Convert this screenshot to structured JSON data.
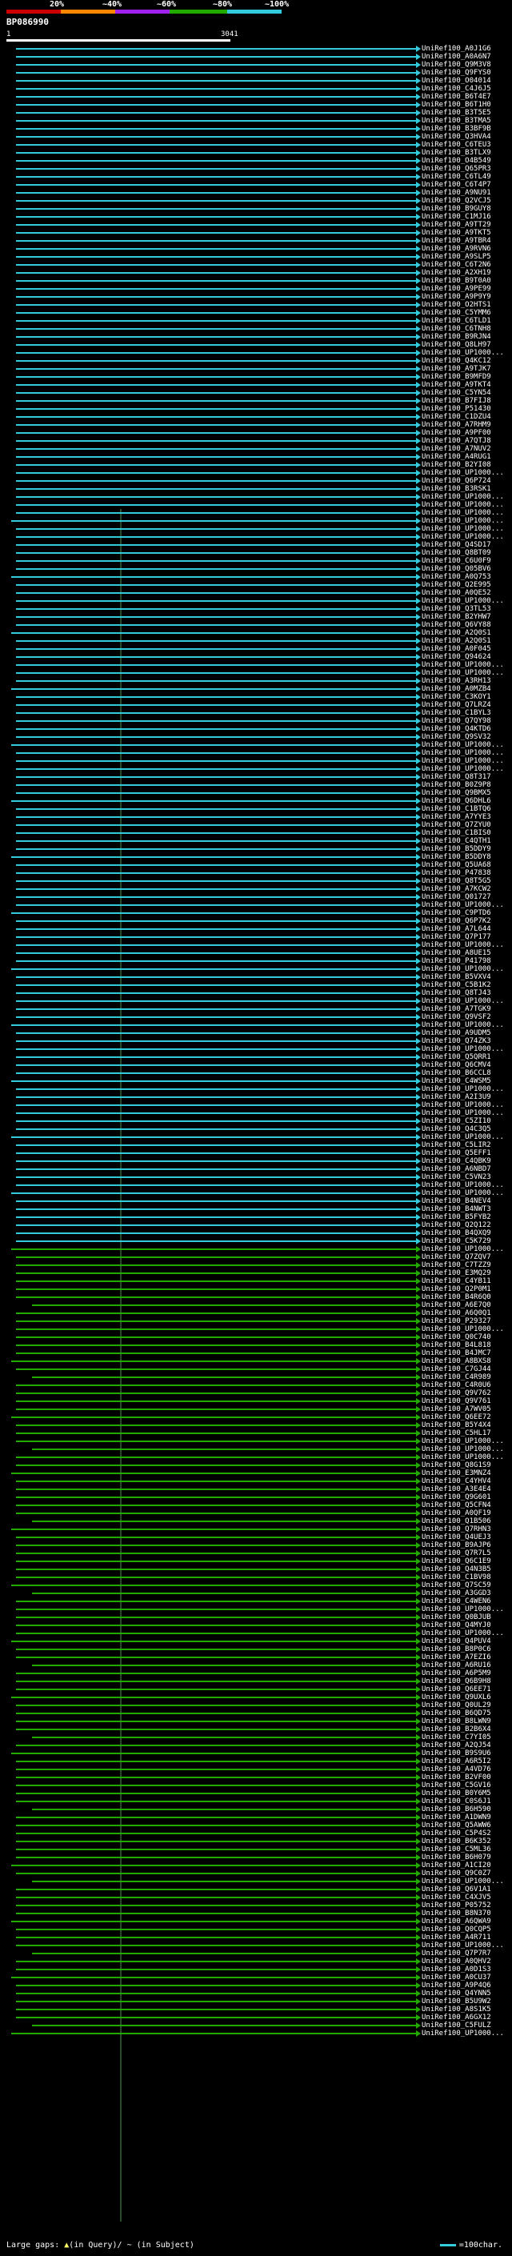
{
  "scale": {
    "labels": [
      "20%",
      "~40%",
      "~60%",
      "~80%",
      "~100%"
    ],
    "colors": [
      "#cc0000",
      "#ff8800",
      "#a020f0",
      "#22aa00",
      "#33ccdd"
    ]
  },
  "query": {
    "title": "BP086990",
    "start": "1",
    "end": "3041"
  },
  "hits": {
    "labels": [
      "UniRef100_A0J1G6",
      "UniRef100_A0A6N7",
      "UniRef100_Q9M3V8",
      "UniRef100_Q9FYS0",
      "UniRef100_O04014",
      "UniRef100_C4J6J5",
      "UniRef100_B6T4E7",
      "UniRef100_B6T1H0",
      "UniRef100_B3T5E5",
      "UniRef100_B3TMA5",
      "UniRef100_B3BF9B",
      "UniRef100_Q3HVA4",
      "UniRef100_C6TEU3",
      "UniRef100_B3TLX9",
      "UniRef100_O4B549",
      "UniRef100_Q65PR3",
      "UniRef100_C6TL49",
      "UniRef100_C6T4P7",
      "UniRef100_A9NU91",
      "UniRef100_Q2VCJ5",
      "UniRef100_B9GUY8",
      "UniRef100_C1MJ16",
      "UniRef100_A9TT29",
      "UniRef100_A9TKT5",
      "UniRef100_A9TBR4",
      "UniRef100_A9RVN6",
      "UniRef100_A9SLP5",
      "UniRef100_C6T2N6",
      "UniRef100_A2XH19",
      "UniRef100_B9T0A0",
      "UniRef100_A9PE99",
      "UniRef100_A9P9Y9",
      "UniRef100_O2HTS1",
      "UniRef100_C5YMM6",
      "UniRef100_C6TLD1",
      "UniRef100_C6TNH8",
      "UniRef100_B9RJN4",
      "UniRef100_Q8LH97",
      "UniRef100_UP1000...",
      "UniRef100_Q4KC12",
      "UniRef100_A9TJK7",
      "UniRef100_B9MFD9",
      "UniRef100_A9TKT4",
      "UniRef100_C5YN54",
      "UniRef100_B7FIJ8",
      "UniRef100_P51430",
      "UniRef100_C1DZU4",
      "UniRef100_A7RHM9",
      "UniRef100_A9PF00",
      "UniRef100_A7QTJ8",
      "UniRef100_A7NUV2",
      "UniRef100_A4RUG1",
      "UniRef100_B2YI08",
      "UniRef100_UP1000...",
      "UniRef100_Q6P724",
      "UniRef100_B3RSK1",
      "UniRef100_UP1000...",
      "UniRef100_UP1000...",
      "UniRef100_UP1000...",
      "UniRef100_UP1000...",
      "UniRef100_UP1000...",
      "UniRef100_UP1000...",
      "UniRef100_Q4SD17",
      "UniRef100_Q8BT09",
      "UniRef100_C6U0F9",
      "UniRef100_Q05BV6",
      "UniRef100_A0Q753",
      "UniRef100_Q2E995",
      "UniRef100_A0QE52",
      "UniRef100_UP1000...",
      "UniRef100_Q3TL53",
      "UniRef100_B2YHW7",
      "UniRef100_Q6VY88",
      "UniRef100_A2Q0S1",
      "UniRef100_A2Q0S1",
      "UniRef100_A0F045",
      "UniRef100_Q94624",
      "UniRef100_UP1000...",
      "UniRef100_UP1000...",
      "UniRef100_A3RH13",
      "UniRef100_A0MZB4",
      "UniRef100_C3KOY1",
      "UniRef100_Q7LRZ4",
      "UniRef100_C1BYL3",
      "UniRef100_Q7QY98",
      "UniRef100_Q4KTD6",
      "UniRef100_Q9SV32",
      "UniRef100_UP1000...",
      "UniRef100_UP1000...",
      "UniRef100_UP1000...",
      "UniRef100_UP1000...",
      "UniRef100_Q8T317",
      "UniRef100_B0Z9P8",
      "UniRef100_Q9BMX5",
      "UniRef100_Q6DHL6",
      "UniRef100_C1BTQ6",
      "UniRef100_A7YYE3",
      "UniRef100_Q7ZYU0",
      "UniRef100_C1BIS0",
      "UniRef100_C4QTH1",
      "UniRef100_B5DDY9",
      "UniRef100_B5DDY8",
      "UniRef100_Q5UA68",
      "UniRef100_P47838",
      "UniRef100_Q8T5G5",
      "UniRef100_A7KCW2",
      "UniRef100_Q01727",
      "UniRef100_UP1000...",
      "UniRef100_C9PTD6",
      "UniRef100_Q6P7K2",
      "UniRef100_A7L644",
      "UniRef100_Q7P177",
      "UniRef100_UP1000...",
      "UniRef100_A8UE15",
      "UniRef100_P41798",
      "UniRef100_UP1000...",
      "UniRef100_B5VXV4",
      "UniRef100_C5B1K2",
      "UniRef100_Q8TJ43",
      "UniRef100_UP1000...",
      "UniRef100_A7TGK9",
      "UniRef100_Q9VSF2",
      "UniRef100_UP1000...",
      "UniRef100_A9UDM5",
      "UniRef100_Q74ZK3",
      "UniRef100_UP1000...",
      "UniRef100_Q5QRR1",
      "UniRef100_Q6CMV4",
      "UniRef100_B6CCL8",
      "UniRef100_C4WSM5",
      "UniRef100_UP1000...",
      "UniRef100_A2I3U9",
      "UniRef100_UP1000...",
      "UniRef100_UP1000...",
      "UniRef100_C5ZI10",
      "UniRef100_Q4C3Q5",
      "UniRef100_UP1000...",
      "UniRef100_C5LIR2",
      "UniRef100_Q5EFF1",
      "UniRef100_C4QBK9",
      "UniRef100_A6NBD7",
      "UniRef100_C5VN23",
      "UniRef100_UP1000...",
      "UniRef100_UP1000...",
      "UniRef100_B4NEV4",
      "UniRef100_B4NWT3",
      "UniRef100_B5FYB2",
      "UniRef100_Q2Q122",
      "UniRef100_B4QXQ9",
      "UniRef100_C5K729",
      "UniRef100_UP1000...",
      "UniRef100_Q7ZQV7",
      "UniRef100_C7TZZ9",
      "UniRef100_E3MQ29",
      "UniRef100_C4YB11",
      "UniRef100_Q2P0M1",
      "UniRef100_B4R6Q0",
      "UniRef100_A6E7Q0",
      "UniRef100_A6Q0Q1",
      "UniRef100_P29327",
      "UniRef100_UP1000...",
      "UniRef100_Q0C740",
      "UniRef100_B4L818",
      "UniRef100_B4JMC7",
      "UniRef100_A8BXS8",
      "UniRef100_C7GJ44",
      "UniRef100_C4R989",
      "UniRef100_C4R0U6",
      "UniRef100_Q9V762",
      "UniRef100_Q9V761",
      "UniRef100_A7WV05",
      "UniRef100_Q6EE72",
      "UniRef100_B5Y4X4",
      "UniRef100_C5HL17",
      "UniRef100_UP1000...",
      "UniRef100_UP1000...",
      "UniRef100_UP1000...",
      "UniRef100_Q8G1S9",
      "UniRef100_E3MNZ4",
      "UniRef100_C4YHV4",
      "UniRef100_A3E4E4",
      "UniRef100_Q9G601",
      "UniRef100_Q5CFN4",
      "UniRef100_A0QF19",
      "UniRef100_Q1B506",
      "UniRef100_Q7RHN3",
      "UniRef100_Q4UEJ3",
      "UniRef100_B9AJP6",
      "UniRef100_Q7R7L5",
      "UniRef100_Q6C1E9",
      "UniRef100_Q4N3B5",
      "UniRef100_C1BV98",
      "UniRef100_Q7SC59",
      "UniRef100_A3GGD3",
      "UniRef100_C4WEN6",
      "UniRef100_UP1000...",
      "UniRef100_Q0BJUB",
      "UniRef100_Q4MYJ0",
      "UniRef100_UP1000...",
      "UniRef100_Q4PUV4",
      "UniRef100_B8P0C6",
      "UniRef100_A7EZI6",
      "UniRef100_A6RU16",
      "UniRef100_A6P5M9",
      "UniRef100_Q6B9H8",
      "UniRef100_Q6EE71",
      "UniRef100_Q9UXL6",
      "UniRef100_Q0UL29",
      "UniRef100_B6QD75",
      "UniRef100_B8LWN9",
      "UniRef100_B2B6X4",
      "UniRef100_C7YI05",
      "UniRef100_A2QJ54",
      "UniRef100_B9S9U6",
      "UniRef100_A6R5I2",
      "UniRef100_A4VD76",
      "UniRef100_B2VF00",
      "UniRef100_C5GV16",
      "UniRef100_B0Y6M5",
      "UniRef100_C0S6J1",
      "UniRef100_B6H590",
      "UniRef100_A1DWN9",
      "UniRef100_Q5AWW6",
      "UniRef100_C5P4S2",
      "UniRef100_B6K352",
      "UniRef100_C5ML36",
      "UniRef100_B6H079",
      "UniRef100_A1CI20",
      "UniRef100_Q9C0Z7",
      "UniRef100_UP1000...",
      "UniRef100_Q6V1A1",
      "UniRef100_C4XJV5",
      "UniRef100_P05752",
      "UniRef100_B8N370",
      "UniRef100_A6QWA9",
      "UniRef100_Q0CQP5",
      "UniRef100_A4R711",
      "UniRef100_UP1000...",
      "UniRef100_Q7P7R7",
      "UniRef100_A0QHV2",
      "UniRef100_A0D1S3",
      "UniRef100_A0CU37",
      "UniRef100_A9P4Q6",
      "UniRef100_Q4YNN5",
      "UniRef100_B5U9W2",
      "UniRef100_A8S1K5",
      "UniRef100_A6GX12",
      "UniRef100_C5FULZ",
      "UniRef100_UP1000..."
    ]
  },
  "footer": {
    "prefix": "Large gaps:",
    "ins_symbol": "▲",
    "ins_text": "(in Query)/",
    "del_symbol": "~",
    "del_text": "(in Subject)",
    "legend_text": "=100char."
  }
}
